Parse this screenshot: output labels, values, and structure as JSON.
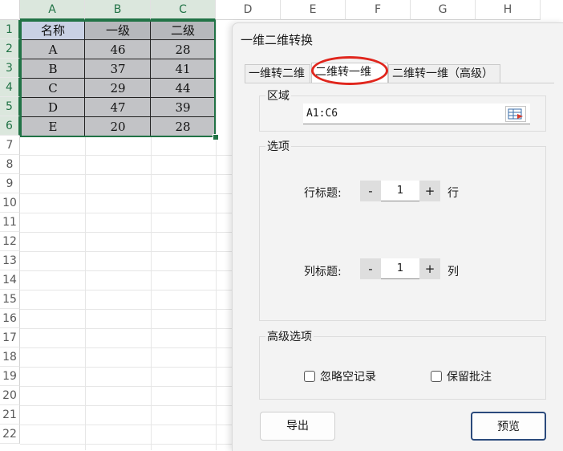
{
  "sheet": {
    "columns": [
      "A",
      "B",
      "C",
      "D",
      "E",
      "F",
      "G",
      "H"
    ],
    "rows": [
      "1",
      "2",
      "3",
      "4",
      "5",
      "6",
      "7",
      "8",
      "9",
      "10",
      "11",
      "12",
      "13",
      "14",
      "15",
      "16",
      "17",
      "18",
      "19",
      "20",
      "21",
      "22"
    ],
    "header": [
      "名称",
      "一级",
      "二级"
    ],
    "data": [
      [
        "A",
        "46",
        "28"
      ],
      [
        "B",
        "37",
        "41"
      ],
      [
        "C",
        "29",
        "44"
      ],
      [
        "D",
        "47",
        "39"
      ],
      [
        "E",
        "20",
        "28"
      ]
    ]
  },
  "dialog": {
    "title": "一维二维转换",
    "tabs": [
      "一维转二维",
      "二维转一维",
      "二维转一维（高级）"
    ],
    "active_tab": "二维转一维",
    "range": {
      "label": "区域",
      "value": "A1:C6"
    },
    "options": {
      "label": "选项",
      "row_title_label": "行标题:",
      "row_title_value": "1",
      "row_unit": "行",
      "col_title_label": "列标题:",
      "col_title_value": "1",
      "col_unit": "列",
      "minus": "-",
      "plus": "+"
    },
    "advanced": {
      "label": "高级选项",
      "ignore_empty": "忽略空记录",
      "keep_comments": "保留批注"
    },
    "buttons": {
      "export": "导出",
      "preview": "预览"
    }
  }
}
